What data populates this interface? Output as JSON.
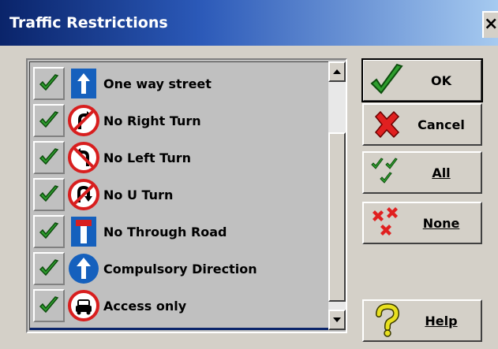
{
  "window": {
    "title": "Traffic Restrictions",
    "close_glyph": "×"
  },
  "list": {
    "items": [
      {
        "label": "One way street",
        "sign": "one-way-sign",
        "checked": true
      },
      {
        "label": "No Right Turn",
        "sign": "no-right-turn-sign",
        "checked": true
      },
      {
        "label": "No Left Turn",
        "sign": "no-left-turn-sign",
        "checked": true
      },
      {
        "label": "No U Turn",
        "sign": "no-u-turn-sign",
        "checked": true
      },
      {
        "label": "No Through Road",
        "sign": "no-through-road-sign",
        "checked": true
      },
      {
        "label": "Compulsory Direction",
        "sign": "compulsory-direction-sign",
        "checked": true
      },
      {
        "label": "Access only",
        "sign": "access-only-sign",
        "checked": true
      }
    ]
  },
  "buttons": {
    "ok": {
      "label": "OK",
      "icon": "checkmark-icon"
    },
    "cancel": {
      "label": "Cancel",
      "icon": "red-x-icon"
    },
    "all": {
      "label": "All",
      "icon": "multi-check-icon"
    },
    "none": {
      "label": "None",
      "icon": "multi-x-icon"
    },
    "help": {
      "label": "Help",
      "icon": "question-mark-icon"
    }
  },
  "colors": {
    "title_bar_start": "#0a246a",
    "title_bar_end": "#a6caf0",
    "check_green": "#2e9e2e",
    "sign_blue": "#1560bd",
    "sign_red": "#d81e1e"
  }
}
